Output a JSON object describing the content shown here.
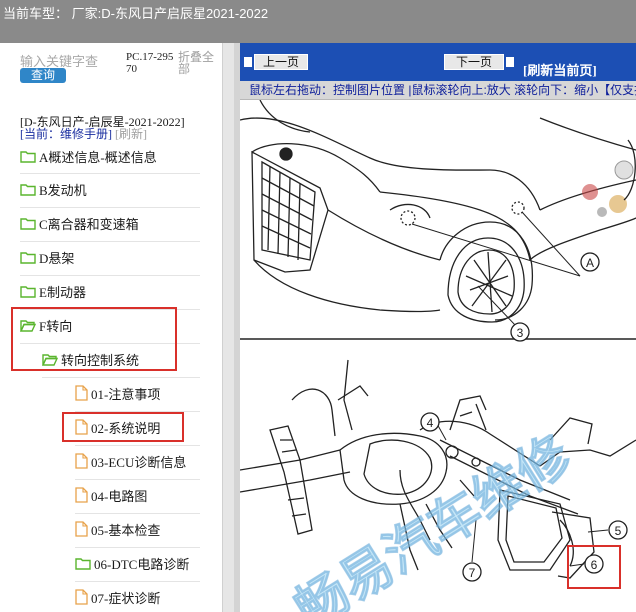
{
  "header": {
    "title": "当前车型：  厂家:D-东风日产启辰星2021-2022"
  },
  "left_panel": {
    "search_placeholder": "输入关键字查",
    "query_button": "查询",
    "pc_code": "PC.17-29570",
    "fold_all": "折叠全部",
    "model_line": "[D-东风日产-启辰星-2021-2022]",
    "current_label": "[当前：维修手册]",
    "refresh_link": "[刷新]",
    "tree": [
      {
        "label": "A概述信息-概述信息",
        "icon": "folder-icon",
        "open": false
      },
      {
        "label": "B发动机",
        "icon": "folder-icon",
        "open": false
      },
      {
        "label": "C离合器和变速箱",
        "icon": "folder-icon",
        "open": false
      },
      {
        "label": "D悬架",
        "icon": "folder-icon",
        "open": false
      },
      {
        "label": "E制动器",
        "icon": "folder-icon",
        "open": false
      },
      {
        "label": "F转向",
        "icon": "folder-open-icon",
        "open": true
      },
      {
        "label": "转向控制系统",
        "icon": "folder-open-icon",
        "open": true
      },
      {
        "label": "01-注意事项",
        "icon": "document-icon"
      },
      {
        "label": "02-系统说明",
        "icon": "document-icon",
        "selected": true
      },
      {
        "label": "03-ECU诊断信息",
        "icon": "document-icon"
      },
      {
        "label": "04-电路图",
        "icon": "document-icon"
      },
      {
        "label": "05-基本检查",
        "icon": "document-icon"
      },
      {
        "label": "06-DTC电路诊断",
        "icon": "folder-icon",
        "open": false
      },
      {
        "label": "07-症状诊断",
        "icon": "document-icon"
      }
    ]
  },
  "viewer": {
    "prev_button": "上一页",
    "next_button": "下一页",
    "refresh_page": "[刷新当前页]",
    "hint": "鼠标左右拖动：控制图片位置 |鼠标滚轮向上:放大  滚轮向下：缩小【仅支持IE"
  },
  "figure": {
    "callouts": [
      "A",
      "3",
      "4",
      "5",
      "6",
      "7"
    ],
    "watermark": "畅易汽车维修"
  },
  "colors": {
    "title_bar": "#8a8a8a",
    "nav_bar": "#1c4fb4",
    "query_button": "#2f86c8",
    "highlight": "#d9302a",
    "folder": "#5ab52e",
    "document": "#e8a24a"
  }
}
